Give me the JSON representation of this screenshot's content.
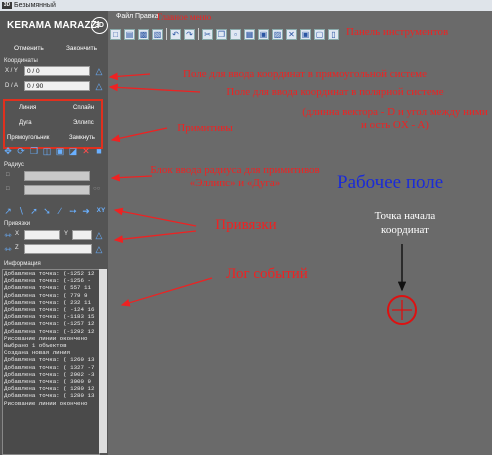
{
  "window": {
    "app_icon": "3D",
    "title": "Безымянный"
  },
  "logo": {
    "brand": "KERAMA MARAZZI",
    "badge": "3D"
  },
  "history": {
    "undo_label": "Отменить",
    "finish_label": "Закончить"
  },
  "coords": {
    "section_label": "Координаты",
    "xy_label": "X / Y",
    "xy_value": "0 / 0",
    "da_label": "D / A",
    "da_value": "0 / 90"
  },
  "primitives": {
    "line": "Линия",
    "spline": "Сплайн",
    "arc": "Дуга",
    "ellipse": "Эллипс",
    "rectangle": "Прямоугольник",
    "close": "Замкнуть"
  },
  "radius": {
    "section_label": "Радиус"
  },
  "snaps": {
    "xy_icon": "XY"
  },
  "bindings": {
    "section_label": "Привязки",
    "x_label": "X",
    "y_label": "Y",
    "z_label": "Z"
  },
  "log": {
    "section_label": "Информация",
    "lines": [
      "Добавлена точка: (-1252  12",
      "Добавлена точка: (-1256   -",
      "Добавлена точка: (  557  11",
      "Добавлена точка: (  779   9",
      "Добавлена точка: (  232  11",
      "Добавлена точка: ( -124  16",
      "Добавлена точка: (-1183  15",
      "Добавлена точка: (-1257  12",
      "Добавлена точка: (-1292  12",
      "Рисование линии окончено",
      "Выбрано 1 объектов",
      "Создана новая линия",
      "Добавлена точка: ( 1260  13",
      "Добавлена точка: ( 1327  -7",
      "Добавлена точка: ( 2902  -3",
      "Добавлена точка: ( 3000   9",
      "Добавлена точка: ( 1280  12",
      "Добавлена точка: ( 1280  13",
      "Рисование линии окончено"
    ]
  },
  "menu": {
    "file": "Файл",
    "edit": "Правка",
    "note": "Главное меню"
  },
  "annotations": {
    "toolbar": "Панель инструментов",
    "rect_input": "Поле для ввода координат в прямоугольной системе",
    "polar_input": "Поле для ввода координат в полярной системе",
    "polar_hint": "(длинна вектора - D и угол между ними и ость OX - A)",
    "primitives": "Примитивы",
    "radius_block": "Блок ввода радиуса для примитивов «Эллипс» и «Дуга»",
    "snaps": "Привязки",
    "log": "Лог событий",
    "workspace": "Рабочее поле",
    "origin": "Точка начала координат"
  },
  "colors": {
    "annotation": "#ee2222",
    "workspace_title": "#1a2bd8",
    "origin_marker": "#dd1111",
    "background": "#6a6a6a",
    "sidebar": "#545454"
  }
}
